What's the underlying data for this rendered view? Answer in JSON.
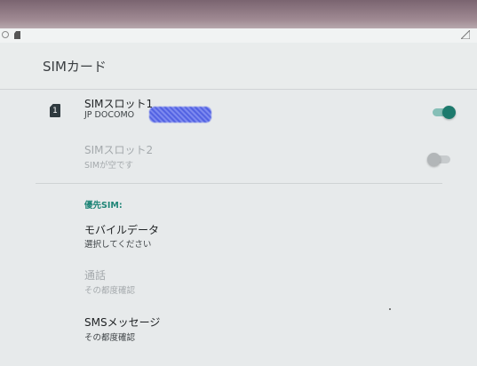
{
  "app_bar": {
    "title": "SIMカード"
  },
  "sim_slots": [
    {
      "label": "SIMスロット1",
      "slot_icon": "1",
      "carrier": "JP DOCOMO",
      "enabled": true
    },
    {
      "label": "SIMスロット2",
      "status": "SIMが空です",
      "enabled": false
    }
  ],
  "preferred": {
    "header": "優先SIM:",
    "items": [
      {
        "title": "モバイルデータ",
        "value": "選択してください"
      },
      {
        "title": "通話",
        "value": "その都度確認"
      },
      {
        "title": "SMSメッセージ",
        "value": "その都度確認"
      }
    ]
  },
  "colors": {
    "accent": "#1d7a6d",
    "header_text": "#1f8577",
    "disabled_text": "#a4a9ac"
  }
}
